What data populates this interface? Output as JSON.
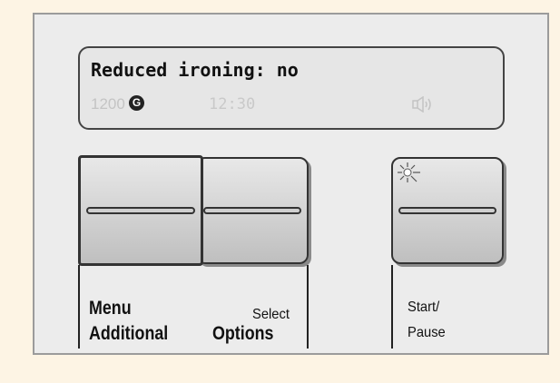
{
  "display": {
    "message": "Reduced ironing: no",
    "spin_speed": "1200",
    "spin_symbol": "G",
    "time": "12:30",
    "sound_icon": "speaker-icon"
  },
  "buttons": {
    "menu_label_line1": "Menu",
    "menu_label_line2": "Additional",
    "select_label_line1": "Select",
    "select_label_line2": "Options",
    "start_label_line1": "Start/",
    "start_label_line2": "Pause",
    "start_indicator_icon": "led-light-icon"
  }
}
